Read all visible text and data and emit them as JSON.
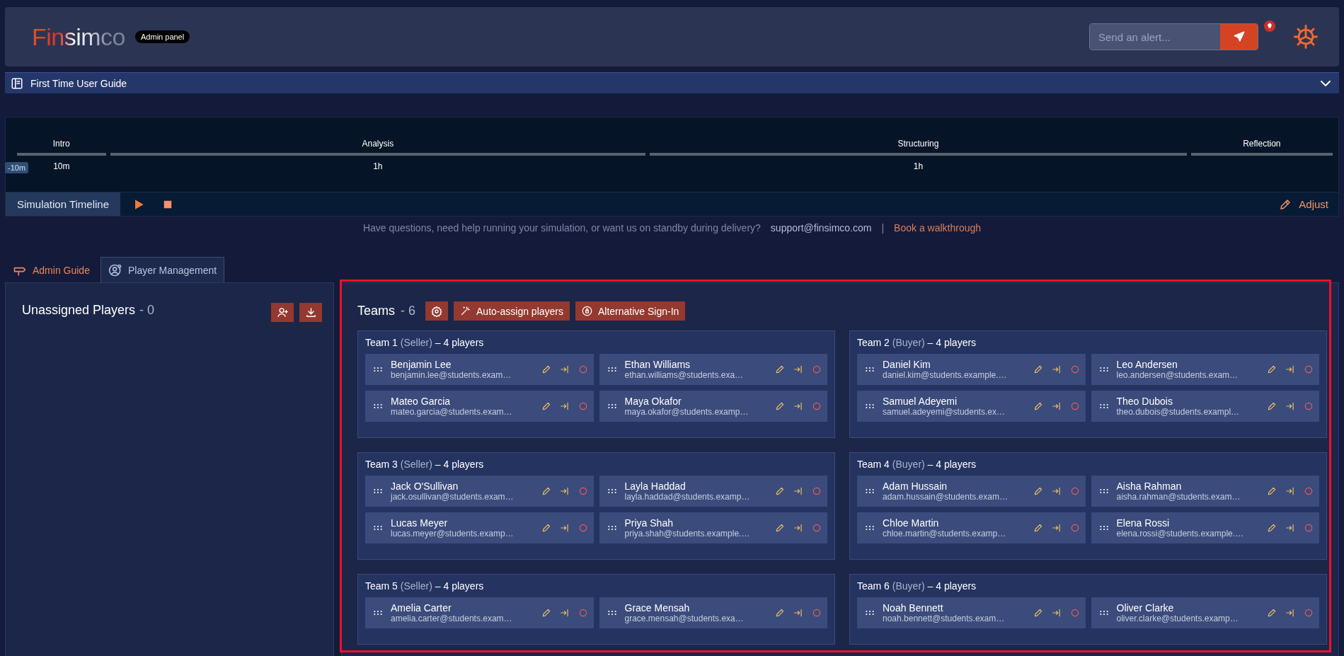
{
  "header": {
    "logo": "Finsimco",
    "badge": "Admin panel",
    "alert_field": {
      "placeholder": "Send an alert..."
    }
  },
  "guide_bar": {
    "title": "First Time User Guide"
  },
  "timeline": {
    "current_marker": "-10m",
    "phases": [
      {
        "name": "Intro",
        "duration": "10m"
      },
      {
        "name": "Analysis",
        "duration": "1h"
      },
      {
        "name": "Structuring",
        "duration": "1h"
      },
      {
        "name": "Reflection"
      }
    ],
    "label": "Simulation Timeline",
    "adjust": "Adjust"
  },
  "help": {
    "text": "Have questions, need help running your simulation, or want us on standby during delivery?",
    "email": "support@finsimco.com",
    "separator": "|",
    "link": "Book a walkthrough"
  },
  "tabs": [
    {
      "label": "Admin Guide",
      "selected": false
    },
    {
      "label": "Player Management",
      "selected": true
    }
  ],
  "unassigned": {
    "title": "Unassigned Players",
    "count": "- 0"
  },
  "teams_panel": {
    "title": "Teams",
    "count": "- 6",
    "buttons": [
      {
        "label": "Auto-assign players"
      },
      {
        "label": "Alternative Sign-In"
      }
    ],
    "teams": [
      {
        "name": "Team 1",
        "role": "(Seller)",
        "count": "– 4 players",
        "players": [
          {
            "name": "Benjamin Lee",
            "email": "benjamin.lee@students.exam…"
          },
          {
            "name": "Ethan Williams",
            "email": "ethan.williams@students.exa…"
          },
          {
            "name": "Mateo Garcia",
            "email": "mateo.garcia@students.exam…"
          },
          {
            "name": "Maya Okafor",
            "email": "maya.okafor@students.examp…"
          }
        ]
      },
      {
        "name": "Team 2",
        "role": "(Buyer)",
        "count": "– 4 players",
        "players": [
          {
            "name": "Daniel Kim",
            "email": "daniel.kim@students.example.…"
          },
          {
            "name": "Leo Andersen",
            "email": "leo.andersen@students.exam…"
          },
          {
            "name": "Samuel Adeyemi",
            "email": "samuel.adeyemi@students.ex…"
          },
          {
            "name": "Theo Dubois",
            "email": "theo.dubois@students.exampl…"
          }
        ]
      },
      {
        "name": "Team 3",
        "role": "(Seller)",
        "count": "– 4 players",
        "players": [
          {
            "name": "Jack O'Sullivan",
            "email": "jack.osullivan@students.exam…"
          },
          {
            "name": "Layla Haddad",
            "email": "layla.haddad@students.examp…"
          },
          {
            "name": "Lucas Meyer",
            "email": "lucas.meyer@students.examp…"
          },
          {
            "name": "Priya Shah",
            "email": "priya.shah@students.example.…"
          }
        ]
      },
      {
        "name": "Team 4",
        "role": "(Buyer)",
        "count": "– 4 players",
        "players": [
          {
            "name": "Adam Hussain",
            "email": "adam.hussain@students.exam…"
          },
          {
            "name": "Aisha Rahman",
            "email": "aisha.rahman@students.exam…"
          },
          {
            "name": "Chloe Martin",
            "email": "chloe.martin@students.examp…"
          },
          {
            "name": "Elena Rossi",
            "email": "elena.rossi@students.example.…"
          }
        ]
      },
      {
        "name": "Team 5",
        "role": "(Seller)",
        "count": "– 4 players",
        "players": [
          {
            "name": "Amelia Carter",
            "email": "amelia.carter@students.exam…"
          },
          {
            "name": "Grace Mensah",
            "email": "grace.mensah@students.exa…"
          }
        ]
      },
      {
        "name": "Team 6",
        "role": "(Buyer)",
        "count": "– 4 players",
        "players": [
          {
            "name": "Noah Bennett",
            "email": "noah.bennett@students.exam…"
          },
          {
            "name": "Oliver Clarke",
            "email": "oliver.clarke@students.examp…"
          }
        ]
      }
    ]
  }
}
